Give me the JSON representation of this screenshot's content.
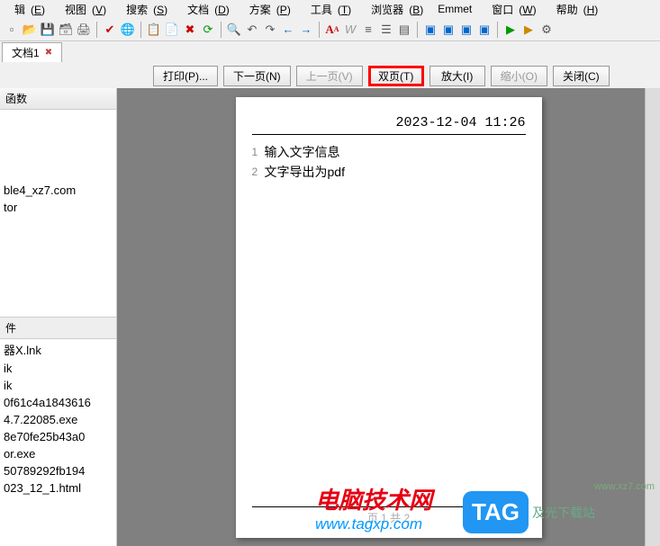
{
  "menu": {
    "items": [
      {
        "label": "辑",
        "accel": "E"
      },
      {
        "label": "视图",
        "accel": "V"
      },
      {
        "label": "搜索",
        "accel": "S"
      },
      {
        "label": "文档",
        "accel": "D"
      },
      {
        "label": "方案",
        "accel": "P"
      },
      {
        "label": "工具",
        "accel": "T"
      },
      {
        "label": "浏览器",
        "accel": "B"
      },
      {
        "label": "Emmet",
        "accel": ""
      },
      {
        "label": "窗口",
        "accel": "W"
      },
      {
        "label": "帮助",
        "accel": "H"
      }
    ]
  },
  "tab": {
    "title": "文档1"
  },
  "sidebar": {
    "header": "函数",
    "topItems": [
      "ble4_xz7.com",
      "tor"
    ],
    "midLabel": "件",
    "files": [
      "器X.lnk",
      "ik",
      "ik",
      "0f61c4a1843616",
      "4.7.22085.exe",
      "8e70fe25b43a0",
      "or.exe",
      "50789292fb194",
      "023_12_1.html"
    ]
  },
  "buttons": {
    "print": "打印(P)...",
    "next": "下一页(N)",
    "prev": "上一页(V)",
    "two": "双页(T)",
    "zoomin": "放大(I)",
    "zoomout": "缩小(O)",
    "close": "关闭(C)"
  },
  "page": {
    "date": "2023-12-04 11:26",
    "lines": [
      {
        "n": "1",
        "text": "输入文字信息"
      },
      {
        "n": "2",
        "text": "文字导出为pdf"
      }
    ],
    "footer": "页 1 共 2"
  },
  "watermarks": {
    "w1_line1": "电脑技术网",
    "w1_line2": "www.tagxp.com",
    "tag": "TAG",
    "w2_text": "及光下载站",
    "w3_text": "www.xz7.com"
  }
}
